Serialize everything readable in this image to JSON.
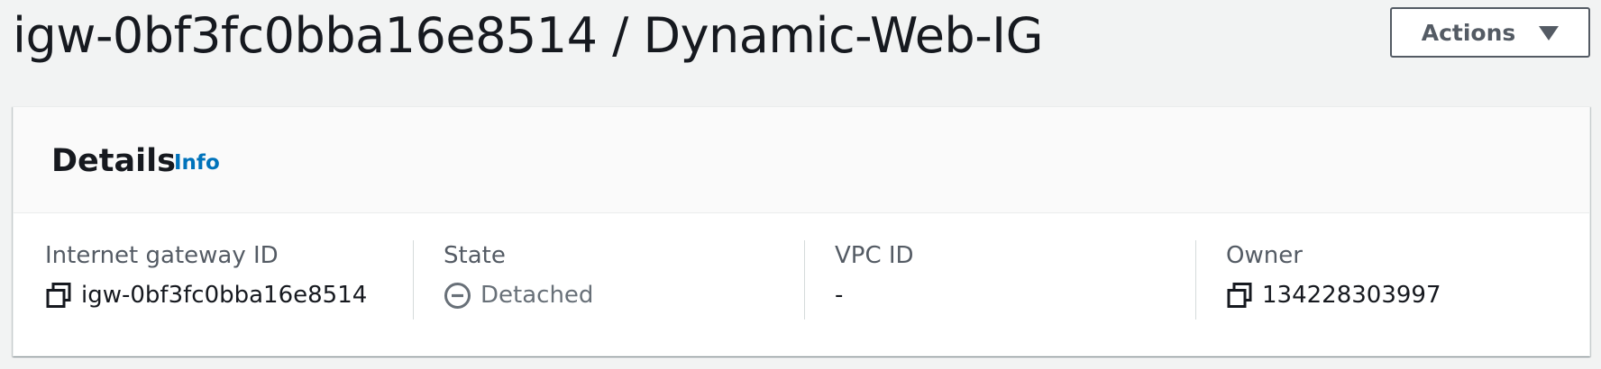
{
  "header": {
    "title": "igw-0bf3fc0bba16e8514 / Dynamic-Web-IG",
    "actions_label": "Actions"
  },
  "details": {
    "title": "Details",
    "info_label": "Info",
    "columns": [
      {
        "label": "Internet gateway ID",
        "value": "igw-0bf3fc0bba16e8514",
        "icon": "copy-icon"
      },
      {
        "label": "State",
        "value": "Detached",
        "icon": "status-stopped-icon"
      },
      {
        "label": "VPC ID",
        "value": "-"
      },
      {
        "label": "Owner",
        "value": "134228303997",
        "icon": "copy-icon"
      }
    ]
  },
  "colors": {
    "background": "#f2f3f3",
    "text": "#16191f",
    "secondary_text": "#545b64",
    "status_text": "#687078",
    "link": "#0073bb"
  }
}
